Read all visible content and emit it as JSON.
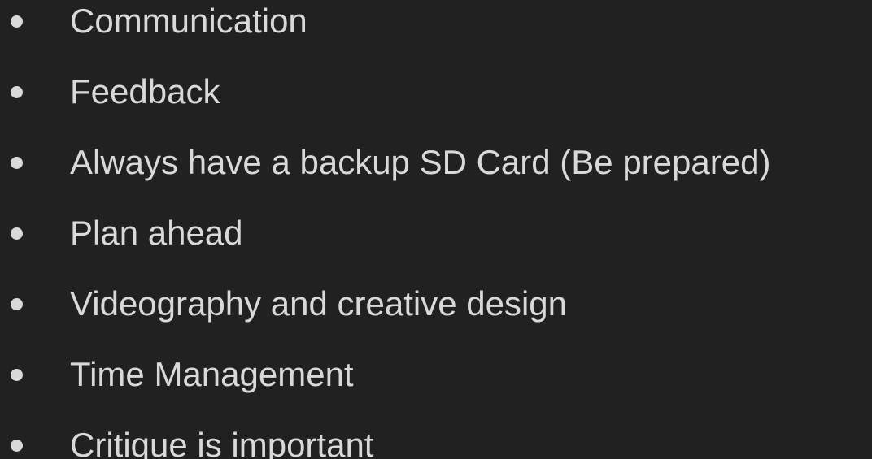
{
  "bullets": [
    {
      "text": "Communication"
    },
    {
      "text": "Feedback"
    },
    {
      "text": "Always have a backup SD Card (Be prepared)"
    },
    {
      "text": "Plan ahead"
    },
    {
      "text": "Videography and creative design"
    },
    {
      "text": "Time Management"
    },
    {
      "text": "Critique is important"
    }
  ],
  "colors": {
    "background": "#212121",
    "text": "#d9d9d9"
  }
}
